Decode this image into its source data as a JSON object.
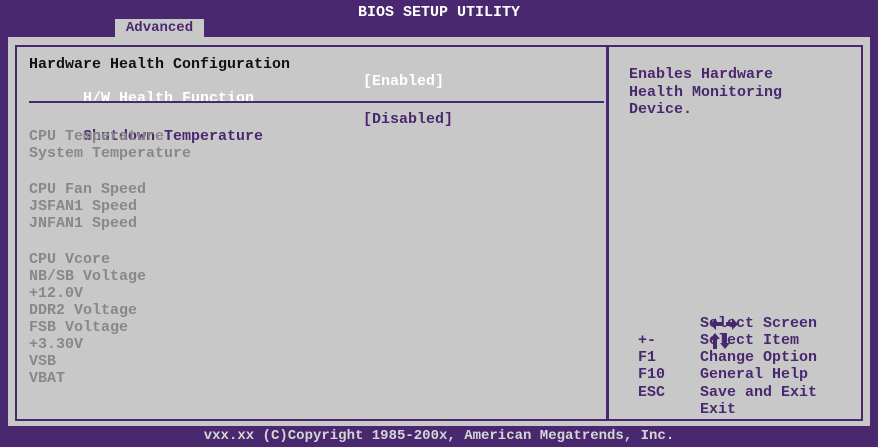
{
  "header": {
    "title": "BIOS SETUP UTILITY",
    "active_tab": "Advanced"
  },
  "main": {
    "section_title": "Hardware Health Configuration",
    "hw_health": {
      "label": "H/W Health Function",
      "value": "[Enabled]"
    },
    "shutdown": {
      "label": "Shutdown Temperature",
      "value": "[Disabled]"
    },
    "temps": [
      "CPU Temperature",
      "System Temperature"
    ],
    "fans": [
      "CPU Fan Speed",
      "JSFAN1 Speed",
      "JNFAN1 Speed"
    ],
    "voltages": [
      "CPU Vcore",
      "NB/SB Voltage",
      "+12.0V",
      "DDR2 Voltage",
      "FSB Voltage",
      "+3.30V",
      "VSB",
      "VBAT"
    ]
  },
  "help": {
    "text": "Enables Hardware\nHealth Monitoring\nDevice."
  },
  "keys": [
    {
      "key_icon": "left-right-arrows-icon",
      "desc": "Select Screen"
    },
    {
      "key_icon": "up-down-arrows-icon",
      "desc": "Select Item"
    },
    {
      "key": "+-",
      "desc": "Change Option"
    },
    {
      "key": "F1",
      "desc": "General Help"
    },
    {
      "key": "F10",
      "desc": "Save and Exit"
    },
    {
      "key": "ESC",
      "desc": "Exit"
    }
  ],
  "footer": {
    "copyright": "vxx.xx (C)Copyright 1985-200x, American Megatrends, Inc."
  },
  "colors": {
    "frame": "#4a2870",
    "panel": "#c8c8c8",
    "highlight_text": "#ffffff",
    "disabled_text": "#888888"
  }
}
